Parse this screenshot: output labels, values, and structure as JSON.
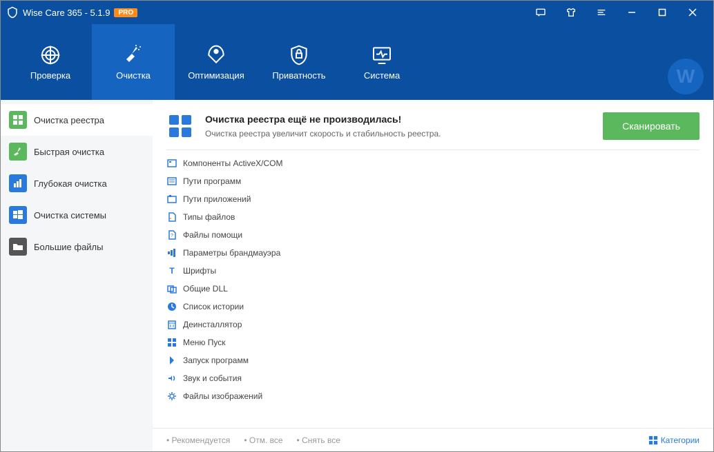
{
  "window": {
    "title": "Wise Care 365 - 5.1.9",
    "badge": "PRO"
  },
  "nav": {
    "tabs": [
      {
        "label": "Проверка"
      },
      {
        "label": "Очистка"
      },
      {
        "label": "Оптимизация"
      },
      {
        "label": "Приватность"
      },
      {
        "label": "Система"
      }
    ]
  },
  "sidebar": {
    "items": [
      {
        "label": "Очистка реестра",
        "color": "#5cb85c"
      },
      {
        "label": "Быстрая очистка",
        "color": "#5cb85c"
      },
      {
        "label": "Глубокая очистка",
        "color": "#2a7ade"
      },
      {
        "label": "Очистка системы",
        "color": "#2a7ade"
      },
      {
        "label": "Большие файлы",
        "color": "#555"
      }
    ]
  },
  "header": {
    "title": "Очистка реестра ещё не производилась!",
    "subtitle": "Очистка реестра увеличит скорость и стабильность реестра.",
    "scan_button": "Сканировать"
  },
  "registry_items": [
    {
      "label": "Компоненты ActiveX/COM"
    },
    {
      "label": "Пути программ"
    },
    {
      "label": "Пути приложений"
    },
    {
      "label": "Типы файлов"
    },
    {
      "label": "Файлы помощи"
    },
    {
      "label": "Параметры брандмауэра"
    },
    {
      "label": "Шрифты"
    },
    {
      "label": "Общие DLL"
    },
    {
      "label": "Список истории"
    },
    {
      "label": "Деинсталлятор"
    },
    {
      "label": "Меню Пуск"
    },
    {
      "label": "Запуск программ"
    },
    {
      "label": "Звук и события"
    },
    {
      "label": "Файлы изображений"
    }
  ],
  "footer": {
    "recommended": "Рекомендуется",
    "check_all": "Отм. все",
    "uncheck_all": "Снять все",
    "categories": "Категории"
  }
}
